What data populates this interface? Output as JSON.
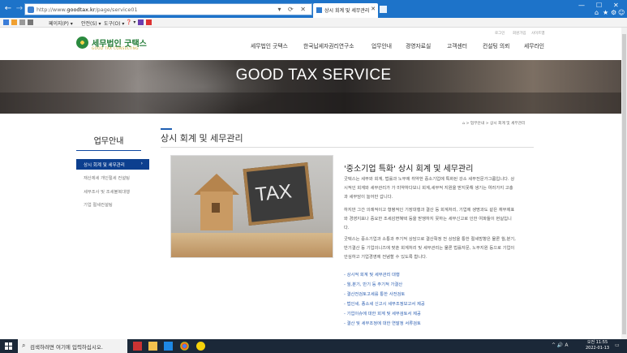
{
  "browser": {
    "url_prefix": "http://www.",
    "url_domain": "goodtax.kr",
    "url_path": "/page/service01",
    "address_controls": "▾ ⟳ ✕",
    "tab_title": "상시 회계 및 세무관리 - 세...",
    "window_controls": [
      "—",
      "☐",
      "✕"
    ],
    "toolbar_icons": [
      "⌂",
      "★",
      "⚙",
      "☺"
    ]
  },
  "commandbar": {
    "items": [
      "페이지(P) ▾",
      "안전(S) ▾",
      "도구(O) ▾",
      "❓ ▾"
    ]
  },
  "site": {
    "logo_name": "세무법인 굿택스",
    "logo_sub": "GOOD TAX CONSULTING",
    "util_links": [
      "로그인",
      "회원가입",
      "사이트맵"
    ],
    "nav": [
      "세무법인 굿택스",
      "한국납세자권리연구소",
      "업무안내",
      "경영자료실",
      "고객센터",
      "컨설팅 의뢰",
      "세무라인"
    ]
  },
  "hero": {
    "title": "GOOD TAX SERVICE"
  },
  "sidebar": {
    "title": "업무안내",
    "active": "상시 회계 및 세무관리",
    "active_arrow": "›",
    "items": [
      "재산제세 개인절세 컨설팅",
      "세무조사 및 조세불복대행",
      "기업 절세컨설팅"
    ]
  },
  "content": {
    "title": "상시 회계 및 세무관리",
    "breadcrumb": "⌂  >  업무안내  >  상시 회계 및 세무관리",
    "image_text": "TAX",
    "heading": "'중소기업 특화' 상시 회계 및 세무관리",
    "paragraphs": [
      "굿택스는 세무와 회계, 법률과 노무에 취약한 중소기업에 특화된 강소 세무전문가그룹입니다. 상",
      "시적인 회계와 세무관리가 가 미약하다보니 회계,세무적 지원을 받지못해 생기는 여러가지 고충",
      "과 세부담이 늘어만 갑니다.",
      "하지만 그간 의례적이고 형평적인 기장대행과 결산 등 회계처리, 기업에 생명과도 같은 재무제표",
      "와 경영지표나 중요한 조세감면혜택 등을 받쟁하지 못하는 세무신고로 인한 여파들이 현실입니",
      "다.",
      "굿택스는 중소기업과 소통과 주기적 상담으로 결산확정 전 상담을 통한 절세방향은 물론 월,분기,",
      "반기결산 등 기업의니즈에 맞춘 회계처리 및 세무관리는 물론 법률자문, 노무지원 등으로 기업이",
      "안심하고 기업경영에 전념할 수 있도록 합니다."
    ],
    "links": [
      "- 상시적 회계 및 세무관리 대행",
      "- 월,분기, 반기 등 주기적 가결산",
      "- 결산전검토고세를 통한 사전검토",
      "- 법인세, 종소세 신고시 세무조정보고서 제공",
      "- 기업이슈에 대한 회계 및 세무검토서 제공",
      "- 결산 및 세무조정에 대한 연말정 서류검토"
    ]
  },
  "taskbar": {
    "search_placeholder": "검색하려면 여기에 입력하십시오.",
    "tray": "^  🔊  A",
    "time": "오전 11:55",
    "date": "2022-01-13"
  },
  "colors": {
    "browser_blue": "#1d73c9",
    "brand_green": "#1f7a34",
    "sidebar_active": "#0c3f8f",
    "link_blue": "#2a5db0"
  }
}
